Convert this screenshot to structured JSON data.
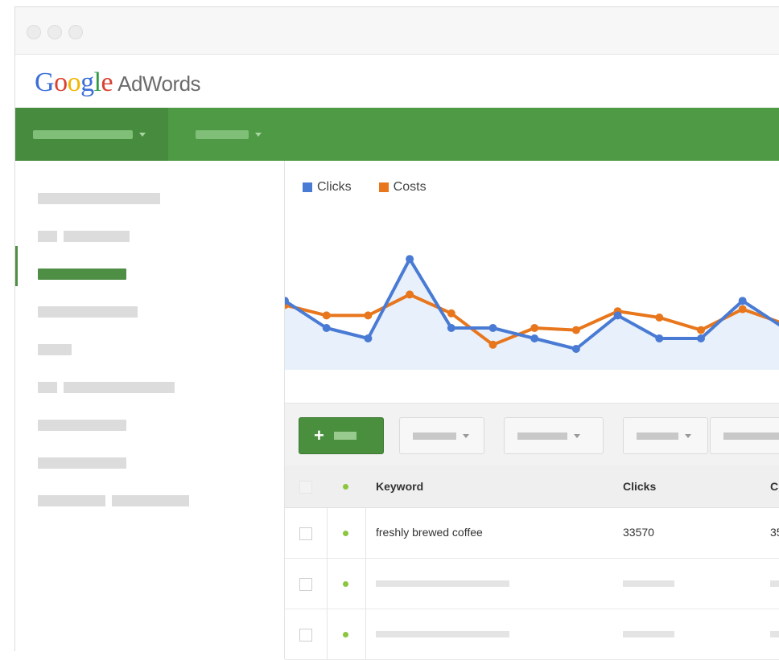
{
  "app": {
    "logo_letters": [
      "G",
      "o",
      "o",
      "g",
      "l",
      "e"
    ],
    "product": "AdWords"
  },
  "chart_data": {
    "type": "line",
    "legend_position": "top-left",
    "grid": false,
    "ylim": [
      0,
      10
    ],
    "series": [
      {
        "name": "Clicks",
        "color": "#4a7bd4",
        "values": [
          3.3,
          2.0,
          1.5,
          5.3,
          2.0,
          2.0,
          1.5,
          1.0,
          2.6,
          1.5,
          1.5,
          3.3,
          2.0
        ]
      },
      {
        "name": "Costs",
        "color": "#e8761c",
        "values": [
          3.1,
          2.6,
          2.6,
          3.6,
          2.7,
          1.2,
          2.0,
          1.9,
          2.8,
          2.5,
          1.9,
          2.9,
          2.2
        ]
      }
    ],
    "area_fill": "#e7f0fb"
  },
  "table": {
    "headers": {
      "keyword": "Keyword",
      "clicks": "Clicks",
      "more": "C"
    },
    "first_row": {
      "keyword": "freshly brewed coffee",
      "clicks": "33570",
      "more": "35"
    }
  },
  "colors": {
    "nav_green": "#4f9a45",
    "add_button": "#4a8f3e",
    "status_active": "#8cc63f"
  }
}
